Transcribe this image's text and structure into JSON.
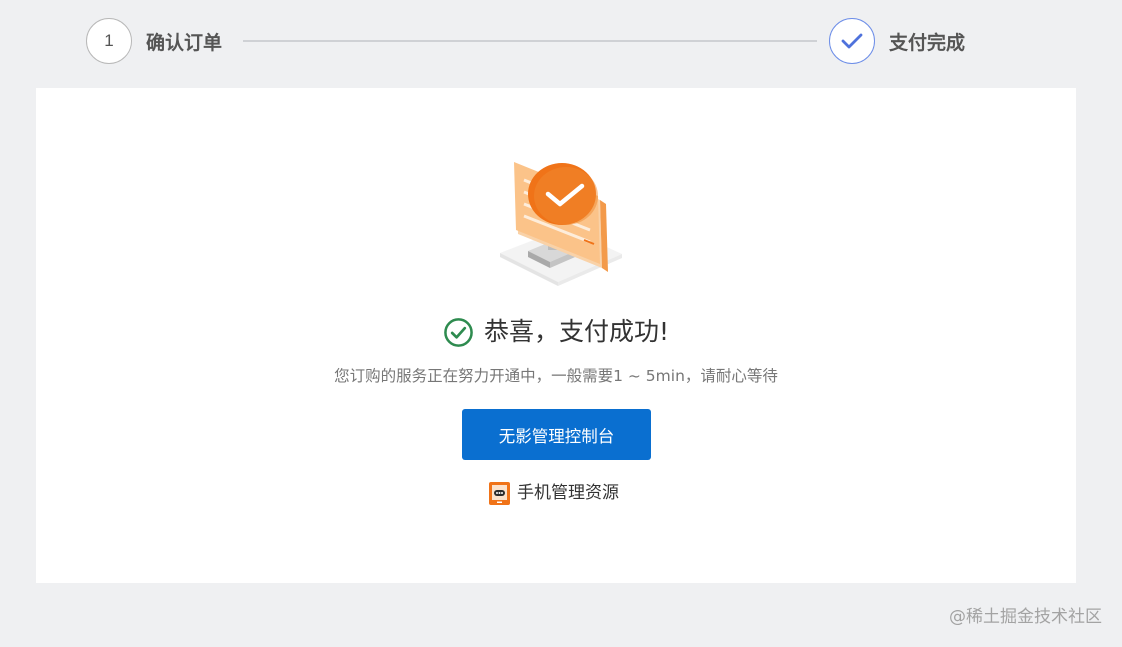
{
  "stepper": {
    "step1": {
      "number": "1",
      "label": "确认订单"
    },
    "step2": {
      "label": "支付完成"
    }
  },
  "result": {
    "title": "恭喜，支付成功!",
    "subtitle": "您订购的服务正在努力开通中，一般需要1 ~ 5min，请耐心等待",
    "console_button_label": "无影管理控制台",
    "mobile_link_label": "手机管理资源"
  },
  "watermark": "@稀土掘金技术社区",
  "icons": {
    "step_done": "checkmark-icon",
    "success": "check-circle-icon",
    "illustration": "monitor-success-illustration",
    "mobile": "phone-icon"
  },
  "colors": {
    "page_background": "#eff0f2",
    "card_background": "#ffffff",
    "primary_button": "#0a6fd0",
    "success_green": "#2e8b4f",
    "step_active_border": "#6d8ee8",
    "illustration_orange": "#f07318"
  }
}
